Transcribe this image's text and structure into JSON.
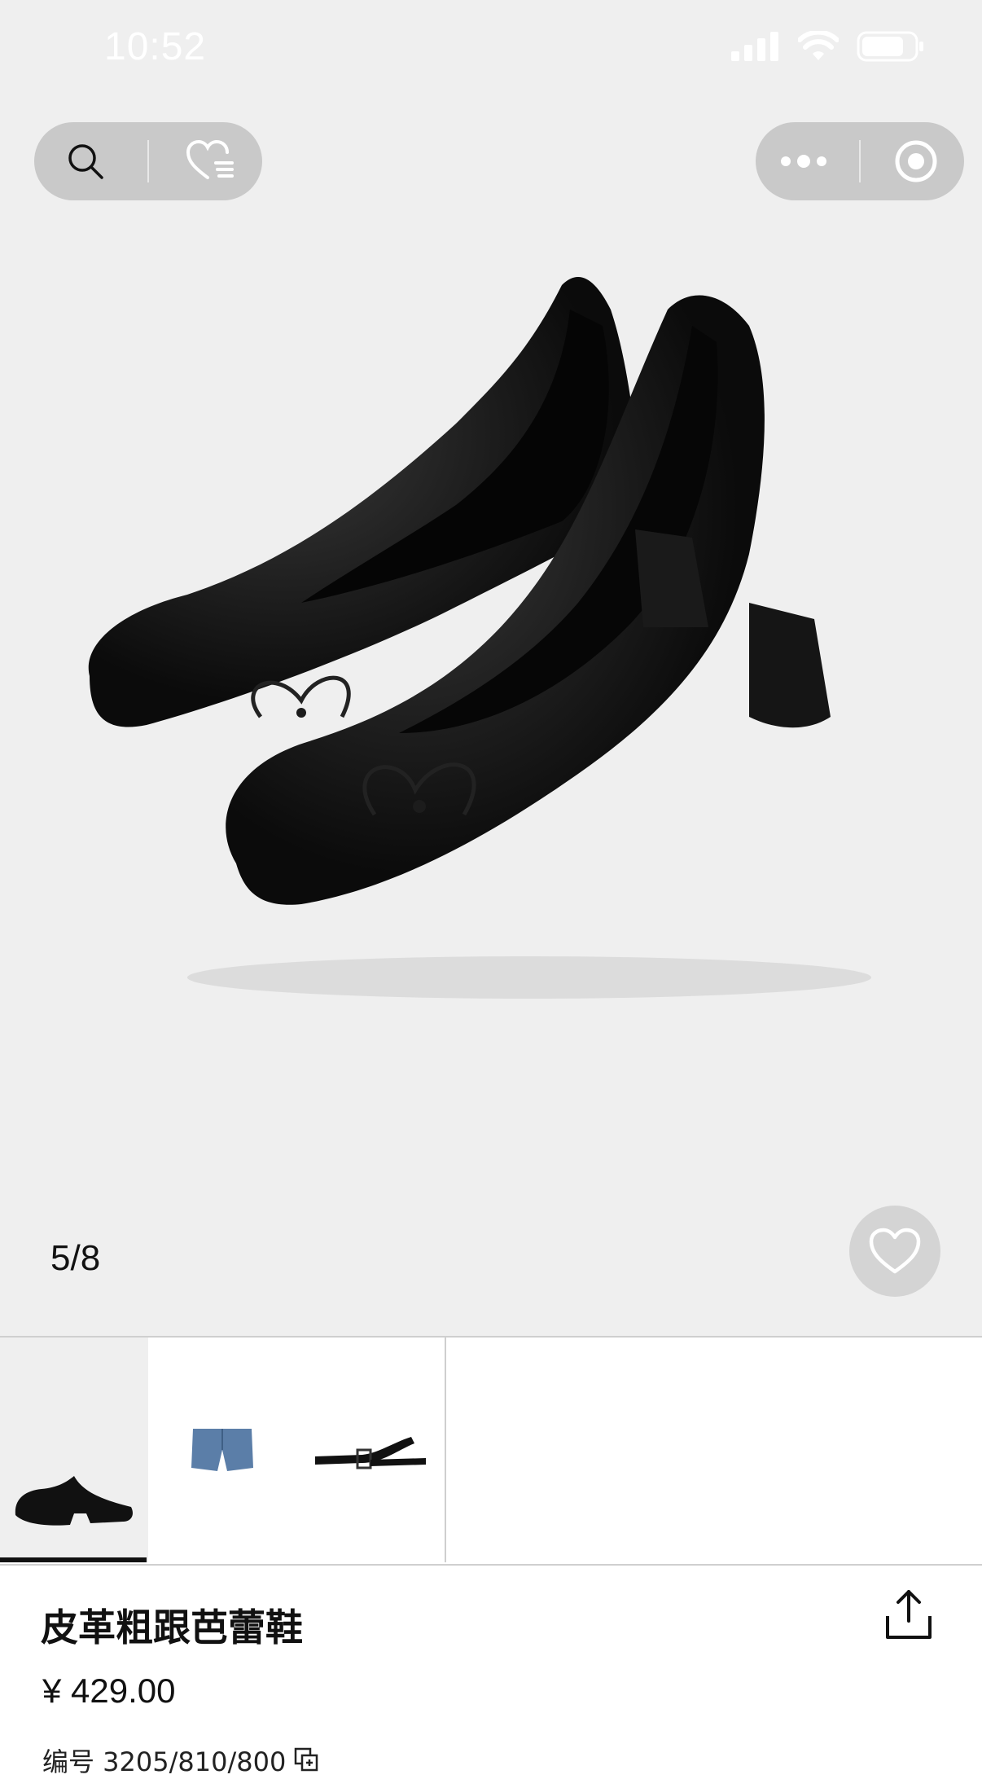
{
  "status_bar": {
    "time": "10:52"
  },
  "gallery": {
    "counter": "5/8"
  },
  "thumbnails": [
    {
      "name": "ballet-flat-thumb",
      "active": true
    },
    {
      "name": "denim-shorts-thumb",
      "active": false
    },
    {
      "name": "belt-thumb",
      "active": false
    }
  ],
  "product": {
    "title": "皮革粗跟芭蕾鞋",
    "price": "¥ 429.00",
    "sku": "编号 3205/810/800"
  },
  "icons": {
    "search": "search-icon",
    "wishlist": "heart-list-icon",
    "more": "more-dots-icon",
    "close": "target-close-icon",
    "favorite": "heart-icon",
    "share": "share-icon",
    "copy": "copy-icon"
  },
  "colors": {
    "hero_bg": "#efefef",
    "capsule_bg": "#c9c9c9",
    "text": "#111111"
  }
}
